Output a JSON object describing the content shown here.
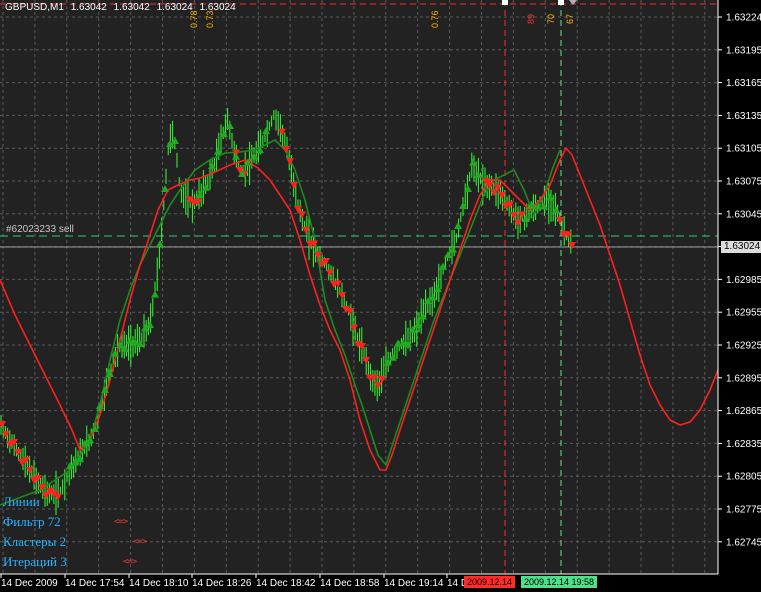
{
  "header": {
    "symbol": "GBPUSD,M1",
    "open": "1.63042",
    "high": "1.63042",
    "low": "1.63024",
    "close": "1.63024"
  },
  "price_axis": [
    "1.63224",
    "1.63195",
    "1.63165",
    "1.63135",
    "1.63105",
    "1.63075",
    "1.63045",
    "1.63015",
    "1.62985",
    "1.62955",
    "1.62925",
    "1.62895",
    "1.62865",
    "1.62835",
    "1.62805",
    "1.62775",
    "1.62745"
  ],
  "time_axis": [
    "14 Dec 2009",
    "14 Dec 17:54",
    "14 Dec 18:10",
    "14 Dec 18:26",
    "14 Dec 18:42",
    "14 Dec 18:58",
    "14 Dec 19:14",
    "14 D"
  ],
  "current_price": "1.63024",
  "order_label": "#62023233 sell",
  "level_labels": [
    "0.78",
    "0.73",
    "0.76",
    "89",
    "70",
    "67"
  ],
  "time_badges": {
    "left": "2009.12.14",
    "right": "2009.12.14 19:58"
  },
  "info_panel": {
    "lines": "Линии",
    "filter": "Фильтр 72",
    "clusters": "Кластеры 2",
    "iterations": "Итераций 3",
    "arrow_filter": "<=>",
    "arrow_clusters": "<=>",
    "arrow_iterations": "<=>"
  },
  "colors": {
    "background": "#000000",
    "plot": "#222222",
    "grid": "#5a5a5a",
    "candle": "#33ff33",
    "red_line": "#ff2020",
    "green_line": "#1f8a1f",
    "order_line": "#2ecc71",
    "vline_red": "#ff2a2a",
    "vline_green": "#6fe08a",
    "label_orange": "#ffb000",
    "text_blue": "#2ab3ff"
  }
}
